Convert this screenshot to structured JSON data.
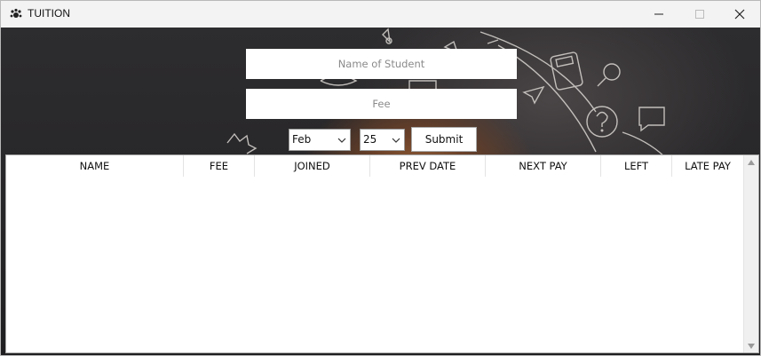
{
  "window": {
    "title": "TUITION",
    "icon": "gear-paw-icon",
    "controls": [
      "minimize-icon",
      "maximize-icon",
      "close-icon"
    ]
  },
  "form": {
    "name_placeholder": "Name of Student",
    "name_value": "",
    "fee_placeholder": "Fee",
    "fee_value": "",
    "month_selected": "Feb",
    "day_selected": "25",
    "submit_label": "Submit"
  },
  "table": {
    "columns": [
      "NAME",
      "FEE",
      "JOINED",
      "PREV DATE",
      "NEXT PAY",
      "LEFT",
      "LATE PAY"
    ],
    "rows": []
  },
  "colors": {
    "titlebar": "#f3f3f3",
    "chalkboard": "#2a292b",
    "glow": "#a0693d"
  }
}
